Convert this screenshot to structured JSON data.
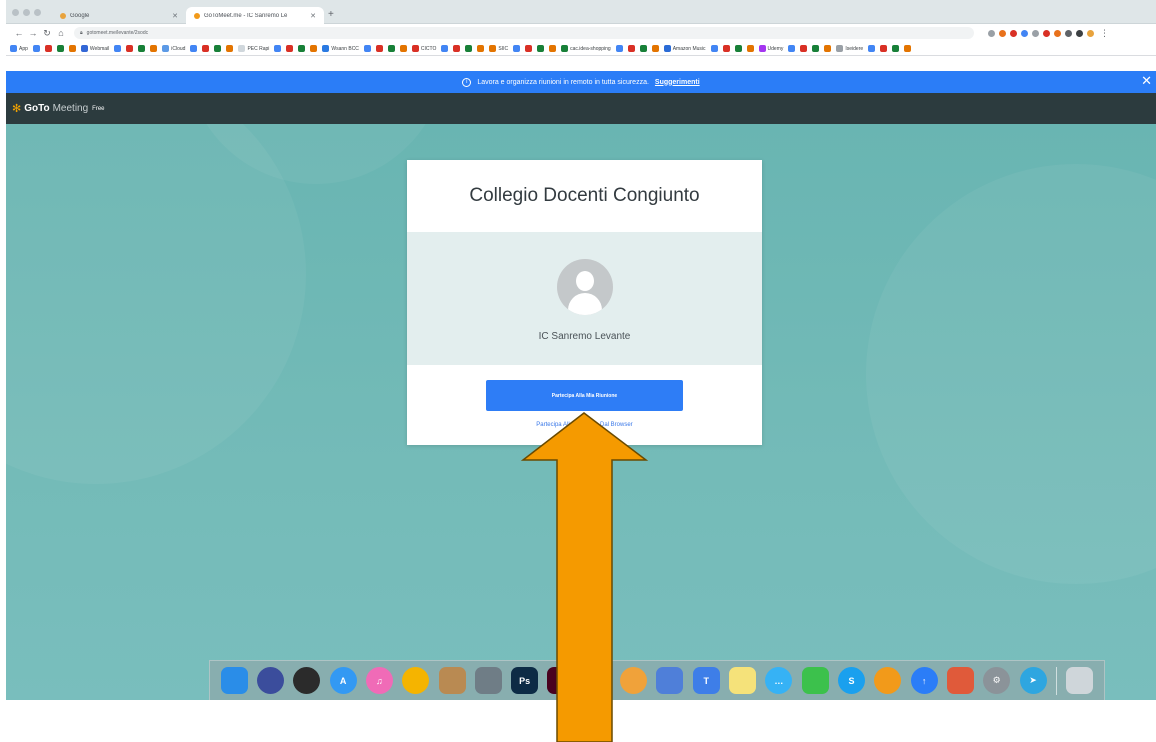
{
  "browser": {
    "tabs": [
      {
        "label": "Google",
        "favicon_color": "#e8a33d"
      },
      {
        "label": "GoToMeet.me - IC Sanremo Le",
        "favicon_color": "#f29a1a"
      }
    ],
    "url": "gotomeet.me/levante/2sodc",
    "bookmarks": [
      {
        "label": "App",
        "color": "#4285f4"
      },
      {
        "label": "Webmail",
        "color": "#3367d6"
      },
      {
        "label": "iCloud",
        "color": "#5c9ae6"
      },
      {
        "label": "PEC Rapi",
        "color": "#d0d7dc"
      },
      {
        "label": "Wsann BCC",
        "color": "#2a7ae2"
      },
      {
        "label": "CICTO",
        "color": "#d93025"
      },
      {
        "label": "SIIC",
        "color": "#e37400"
      },
      {
        "label": "cac.idea-shopping",
        "color": "#188038"
      },
      {
        "label": "Amazon Music",
        "color": "#2a6bd6"
      },
      {
        "label": "Udemy",
        "color": "#a435f0"
      },
      {
        "label": "Iseidere",
        "color": "#9aa0a6"
      }
    ]
  },
  "banner": {
    "text": "Lavora e organizza riunioni in remoto in tutta sicurezza.",
    "link": "Suggerimenti",
    "close": "✕",
    "color": "#2b7df7"
  },
  "app": {
    "logo_prefix": "GoTo",
    "logo_suffix": "Meeting",
    "logo_badge": "Free"
  },
  "card": {
    "title": "Collegio Docenti Congiunto",
    "organizer": "IC Sanremo Levante",
    "join_button": "Partecipa Alla Mia Riunione",
    "browser_link": "Partecipa Alla Riunione Dal Browser",
    "accent": "#2e7df6"
  },
  "dock": [
    {
      "name": "finder-icon",
      "color": "#2a8de8",
      "glyph": ""
    },
    {
      "name": "siri-icon",
      "color": "#3b4d9c",
      "glyph": "",
      "round": true
    },
    {
      "name": "dashboard-icon",
      "color": "#2b2b2b",
      "glyph": "",
      "round": true
    },
    {
      "name": "app-store-icon",
      "color": "#3399f3",
      "glyph": "A",
      "round": true
    },
    {
      "name": "itunes-icon",
      "color": "#f06bb7",
      "glyph": "♫",
      "round": true
    },
    {
      "name": "chrome-icon",
      "color": "#f5b400",
      "glyph": "",
      "round": true
    },
    {
      "name": "notes-app-icon",
      "color": "#b98a52",
      "glyph": ""
    },
    {
      "name": "files-icon",
      "color": "#6f7d86",
      "glyph": ""
    },
    {
      "name": "photoshop-icon",
      "color": "#0d2b45",
      "glyph": "Ps"
    },
    {
      "name": "indesign-icon",
      "color": "#49021f",
      "glyph": "Id"
    },
    {
      "name": "safari-icon",
      "color": "#2f8fe8",
      "glyph": "",
      "round": true
    },
    {
      "name": "photos-icon",
      "color": "#f0a23a",
      "glyph": "",
      "round": true
    },
    {
      "name": "preview-icon",
      "color": "#4f7fd9",
      "glyph": ""
    },
    {
      "name": "keynote-icon",
      "color": "#3e7ee8",
      "glyph": "T"
    },
    {
      "name": "stickies-icon",
      "color": "#f5e27a",
      "glyph": ""
    },
    {
      "name": "messages-icon",
      "color": "#36b2f5",
      "glyph": "…",
      "round": true
    },
    {
      "name": "facetime-icon",
      "color": "#3cc14c",
      "glyph": ""
    },
    {
      "name": "skype-icon",
      "color": "#1aa0ee",
      "glyph": "S",
      "round": true
    },
    {
      "name": "books-icon",
      "color": "#f29a1a",
      "glyph": "",
      "round": true
    },
    {
      "name": "cloud-download-icon",
      "color": "#2b7df7",
      "glyph": "↑",
      "round": true
    },
    {
      "name": "pages-app-icon",
      "color": "#e05a3a",
      "glyph": ""
    },
    {
      "name": "system-preferences-icon",
      "color": "#8b9399",
      "glyph": "⚙",
      "round": true
    },
    {
      "name": "telegram-icon",
      "color": "#2ea6e0",
      "glyph": "➤",
      "round": true
    },
    {
      "name": "trash-icon",
      "color": "#cfd6da",
      "glyph": ""
    }
  ],
  "annotation": {
    "arrow_color": "#f59a00"
  }
}
